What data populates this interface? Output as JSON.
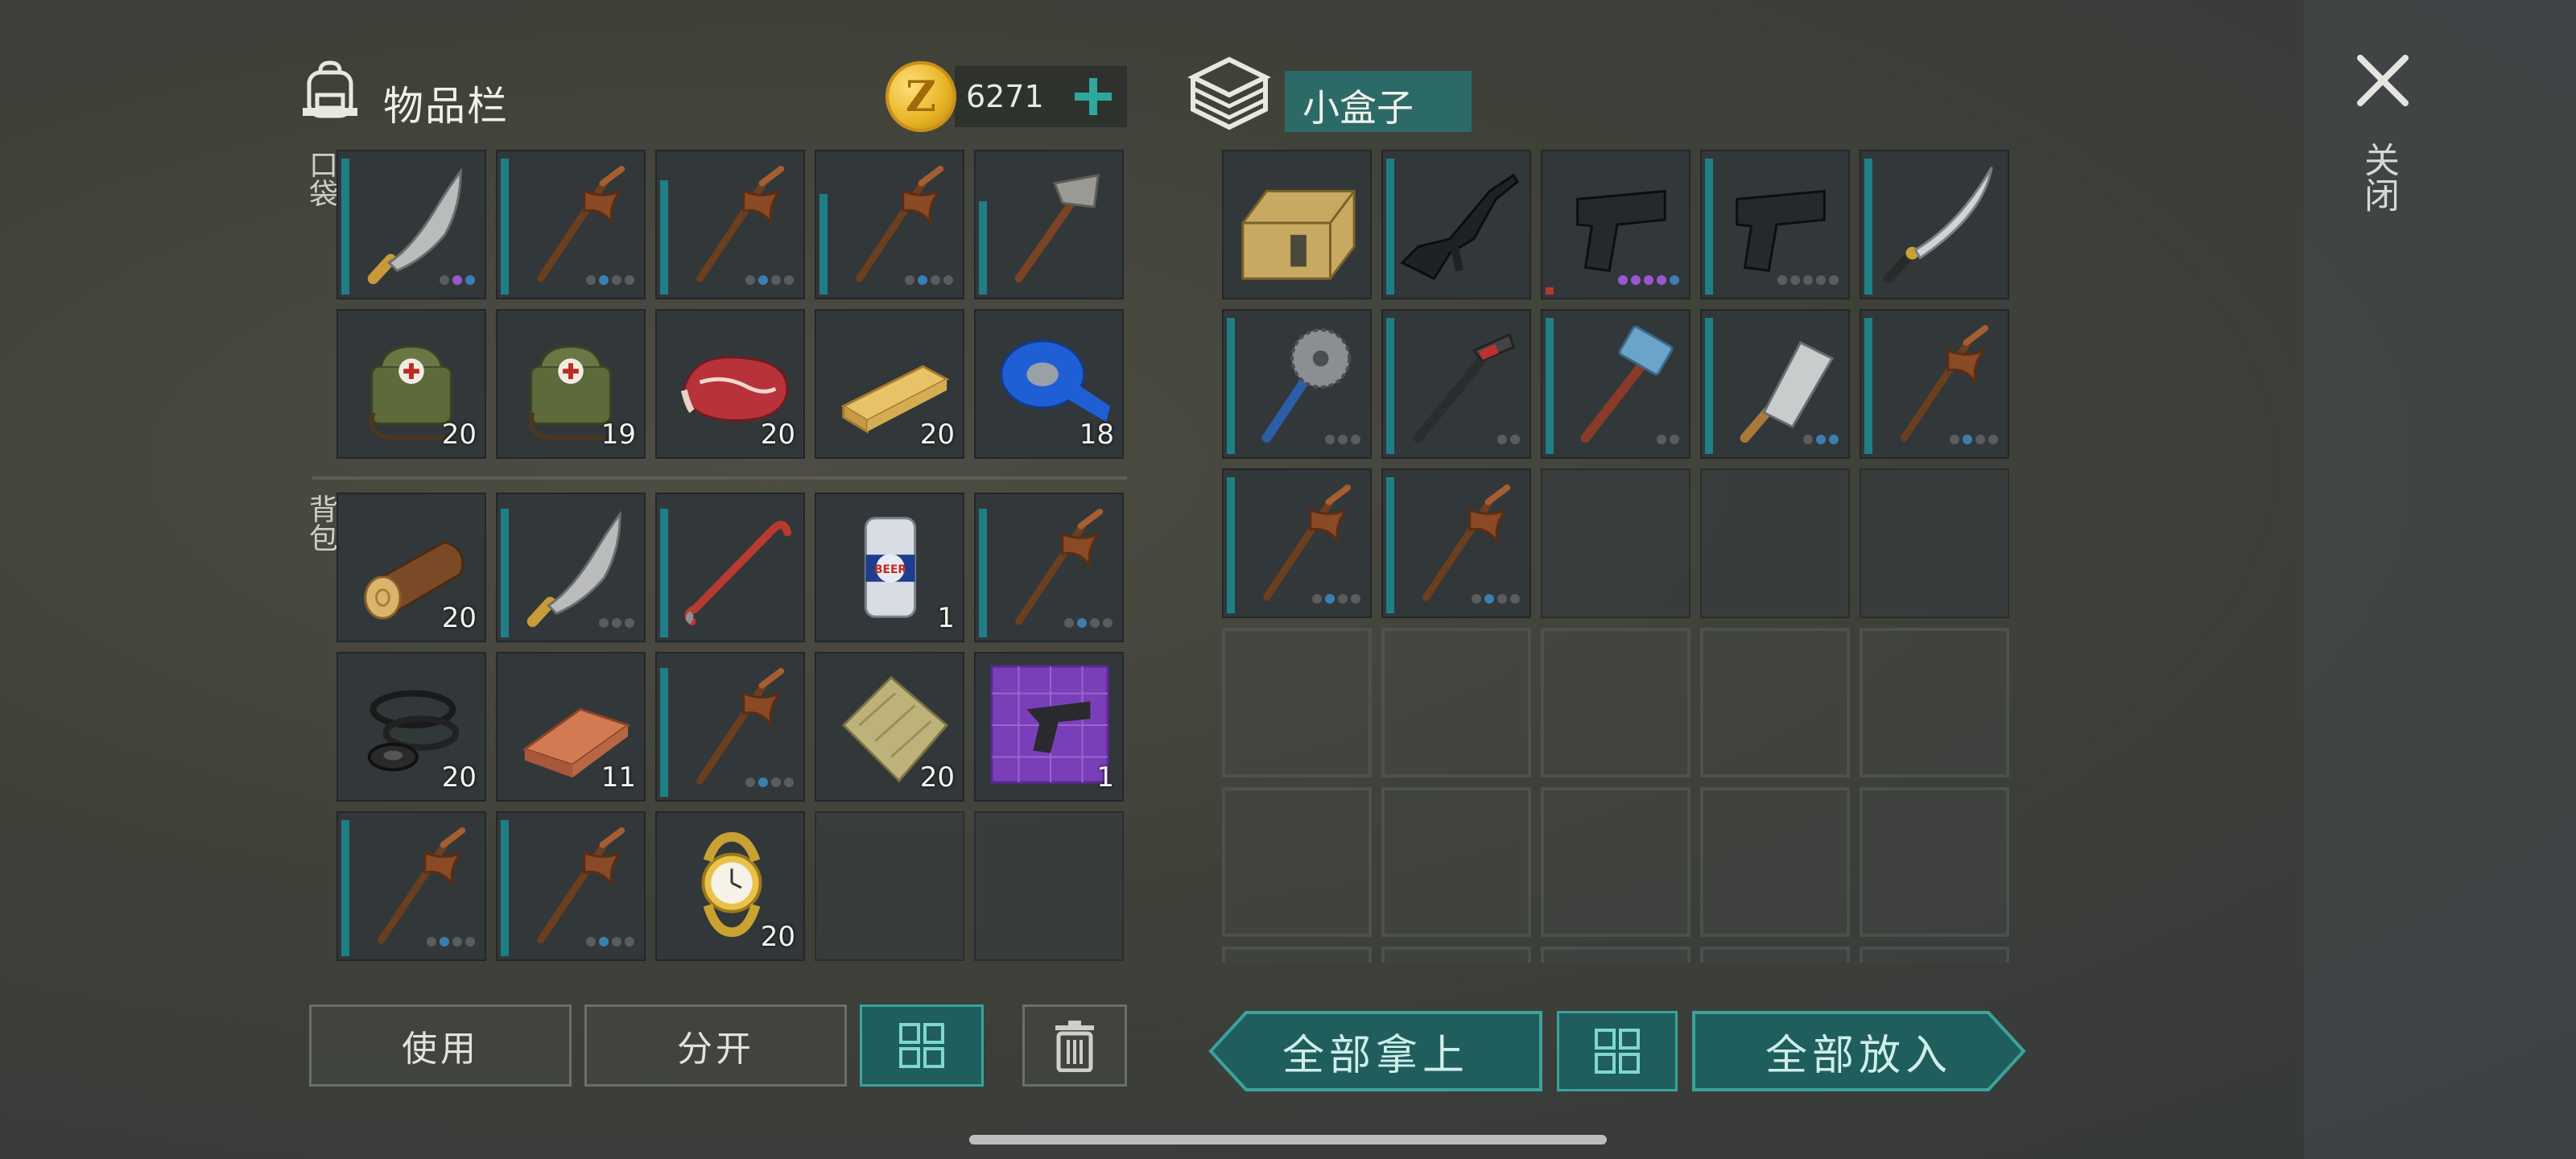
{
  "inventory": {
    "title": "物品栏",
    "coins": "6271",
    "coin_symbol": "Z",
    "pocket_label": "口袋",
    "backpack_label": "背包",
    "pocket": [
      {
        "name": "machete",
        "dur": 0.95,
        "dots": [
          "gray",
          "purple",
          "blue"
        ]
      },
      {
        "name": "pickaxe",
        "dur": 0.95,
        "dots": [
          "gray",
          "blue",
          "gray",
          "gray"
        ]
      },
      {
        "name": "pickaxe",
        "dur": 0.8,
        "dots": [
          "gray",
          "blue",
          "gray",
          "gray"
        ]
      },
      {
        "name": "pickaxe",
        "dur": 0.7,
        "dots": [
          "gray",
          "blue",
          "gray",
          "gray"
        ]
      },
      {
        "name": "stone-hammer",
        "dur": 0.65,
        "dots": []
      },
      {
        "name": "medkit-bag",
        "count": "20"
      },
      {
        "name": "medkit-bag",
        "count": "19"
      },
      {
        "name": "raw-meat",
        "count": "20"
      },
      {
        "name": "wood-plank",
        "count": "20"
      },
      {
        "name": "blue-tape",
        "count": "18"
      }
    ],
    "backpack": [
      {
        "name": "log",
        "count": "20"
      },
      {
        "name": "machete",
        "dur": 0.9,
        "dots": [
          "gray",
          "gray",
          "gray"
        ]
      },
      {
        "name": "crowbar",
        "dur": 0.9,
        "dots": []
      },
      {
        "name": "beer-can",
        "count": "1",
        "label": "BEER"
      },
      {
        "name": "pickaxe",
        "dur": 0.9,
        "dots": [
          "gray",
          "blue",
          "gray",
          "gray"
        ]
      },
      {
        "name": "rubber-rings",
        "count": "20"
      },
      {
        "name": "copper-ingot",
        "count": "11"
      },
      {
        "name": "pickaxe",
        "dur": 0.9,
        "dots": [
          "gray",
          "blue",
          "gray",
          "gray"
        ]
      },
      {
        "name": "cloth",
        "count": "20"
      },
      {
        "name": "pistol-blueprint",
        "count": "1"
      },
      {
        "name": "pickaxe",
        "dur": 0.95,
        "dots": [
          "gray",
          "blue",
          "gray",
          "gray"
        ]
      },
      {
        "name": "pickaxe",
        "dur": 0.95,
        "dots": [
          "gray",
          "blue",
          "gray",
          "gray"
        ]
      },
      {
        "name": "gold-watch",
        "count": "20"
      },
      {
        "name": "empty"
      },
      {
        "name": "empty"
      }
    ],
    "buttons": {
      "use": "使用",
      "split": "分开"
    }
  },
  "container": {
    "title": "小盒子",
    "items": [
      {
        "name": "weapon-crate",
        "dur": 0
      },
      {
        "name": "assault-rifle",
        "dur": 0.95,
        "dots": []
      },
      {
        "name": "pistol",
        "dur": 0.05,
        "red": true,
        "dots": [
          "purple",
          "purple",
          "purple",
          "purple",
          "blue"
        ]
      },
      {
        "name": "pistol",
        "dur": 0.95,
        "dots": [
          "gray",
          "gray",
          "gray",
          "gray",
          "gray"
        ]
      },
      {
        "name": "katana",
        "dur": 0.95,
        "dots": []
      },
      {
        "name": "saw-club",
        "dur": 0.95,
        "dots": [
          "gray",
          "gray",
          "gray"
        ]
      },
      {
        "name": "crowbar-hammer",
        "dur": 0.95,
        "dots": [
          "gray",
          "gray"
        ]
      },
      {
        "name": "sledgehammer",
        "dur": 0.95,
        "dots": [
          "gray",
          "gray"
        ]
      },
      {
        "name": "cleaver",
        "dur": 0.95,
        "dots": [
          "gray",
          "blue",
          "blue"
        ]
      },
      {
        "name": "pickaxe",
        "dur": 0.95,
        "dots": [
          "gray",
          "blue",
          "gray",
          "gray"
        ]
      },
      {
        "name": "pickaxe",
        "dur": 0.95,
        "dots": [
          "gray",
          "blue",
          "gray",
          "gray"
        ]
      },
      {
        "name": "pickaxe",
        "dur": 0.95,
        "dots": [
          "gray",
          "blue",
          "gray",
          "gray"
        ]
      },
      {
        "name": "empty"
      },
      {
        "name": "empty"
      },
      {
        "name": "empty"
      }
    ],
    "locked_rows": 3,
    "buttons": {
      "take_all": "全部拿上",
      "put_all": "全部放入"
    }
  },
  "close_label": "关闭",
  "colors": {
    "accent": "#2b6a66",
    "durability": "#1f7f86",
    "panel": "#32373a"
  }
}
